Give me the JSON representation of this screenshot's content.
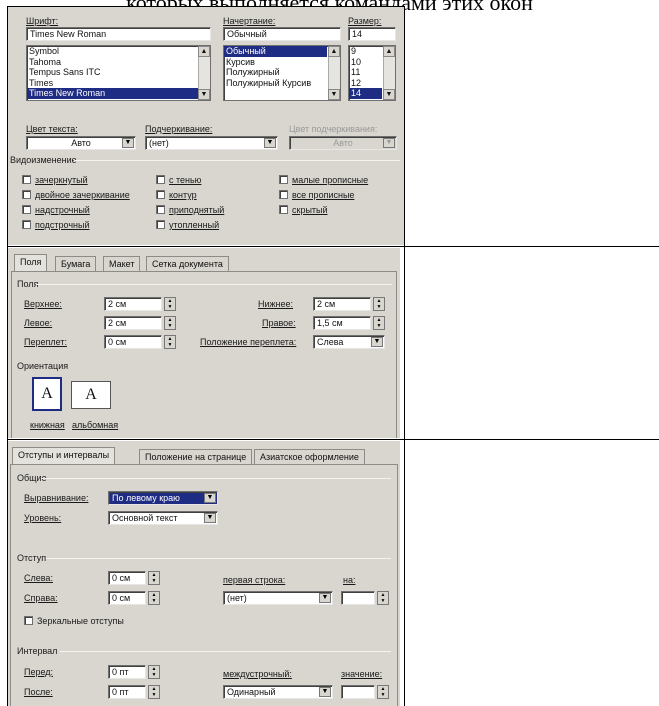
{
  "heading_fragment": "которых выполняется командами этих окон",
  "font_dialog": {
    "font_label": "Шрифт:",
    "font_value": "Times New Roman",
    "font_list": [
      "Symbol",
      "Tahoma",
      "Tempus Sans ITC",
      "Times",
      "Times New Roman"
    ],
    "style_label": "Начертание:",
    "style_value": "Обычный",
    "style_list": [
      "Обычный",
      "Курсив",
      "Полужирный",
      "Полужирный Курсив"
    ],
    "size_label": "Размер:",
    "size_value": "14",
    "size_list": [
      "9",
      "10",
      "11",
      "12",
      "14"
    ],
    "color_label": "Цвет текста:",
    "color_value": "Авто",
    "underline_label": "Подчеркивание:",
    "underline_value": "(нет)",
    "underline_color_label": "Цвет подчеркивания:",
    "underline_color_value": "Авто",
    "effects_label": "Видоизменение",
    "effects": [
      "зачеркнутый",
      "с тенью",
      "малые прописные",
      "двойное зачеркивание",
      "контур",
      "все прописные",
      "надстрочный",
      "приподнятый",
      "скрытый",
      "подстрочный",
      "утопленный"
    ]
  },
  "page_dialog": {
    "tabs": [
      "Поля",
      "Бумага",
      "Макет",
      "Сетка документа"
    ],
    "margins_label": "Поля",
    "top_label": "Верхнее:",
    "top_value": "2 см",
    "bottom_label": "Нижнее:",
    "bottom_value": "2 см",
    "left_label": "Левое:",
    "left_value": "2 см",
    "right_label": "Правое:",
    "right_value": "1,5 см",
    "gutter_label": "Переплет:",
    "gutter_value": "0 см",
    "gutter_pos_label": "Положение переплета:",
    "gutter_pos_value": "Слева",
    "orientation_label": "Ориентация",
    "portrait_label": "книжная",
    "landscape_label": "альбомная",
    "orient_glyph": "A"
  },
  "para_dialog": {
    "tabs": [
      "Отступы и интервалы",
      "Положение на странице",
      "Азиатское оформление"
    ],
    "general_label": "Общие",
    "align_label": "Выравнивание:",
    "align_value": "По левому краю",
    "level_label": "Уровень:",
    "level_value": "Основной текст",
    "indent_label": "Отступ",
    "left_label": "Слева:",
    "left_value": "0 см",
    "right_label": "Справа:",
    "right_value": "0 см",
    "first_line_label": "первая строка:",
    "first_line_value": "(нет)",
    "by_label": "на:",
    "mirror_label": "Зеркальные отступы",
    "spacing_label": "Интервал",
    "before_label": "Перед:",
    "before_value": "0 пт",
    "after_label": "После:",
    "after_value": "0 пт",
    "line_spacing_label": "междустрочный:",
    "line_spacing_value": "Одинарный",
    "value_label": "значение:"
  }
}
